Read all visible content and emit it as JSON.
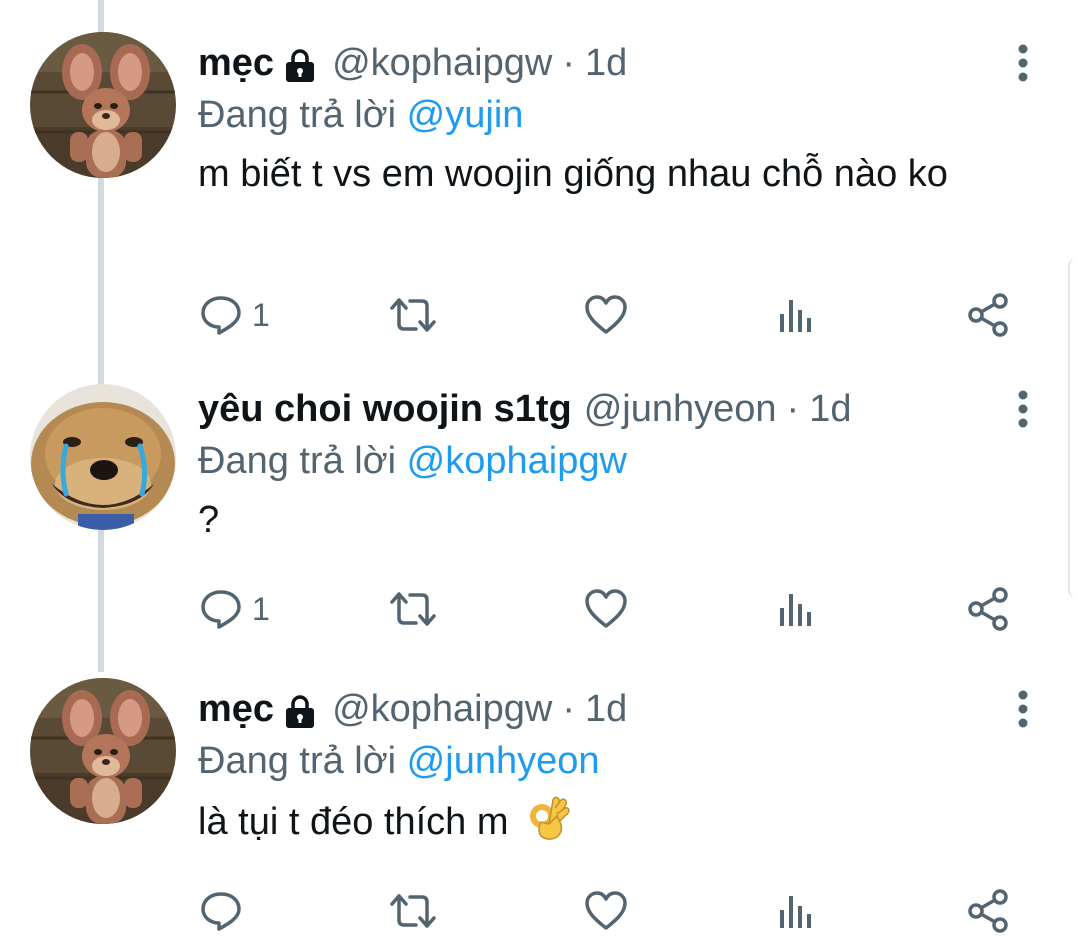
{
  "thread": {
    "tweets": [
      {
        "display_name": "mẹc",
        "locked_icon": "lock-icon",
        "handle": "@kophaipgw",
        "separator": "·",
        "time": "1d",
        "reply_prefix": "Đang trả lời",
        "reply_to": "@yujin",
        "text": "m biết t vs em woojin giống nhau chỗ nào ko",
        "reply_count": "1",
        "avatar": "cartoon-mouse-avatar"
      },
      {
        "display_name": "yêu choi woojin s1tg",
        "handle": "@junhyeon",
        "separator": "·",
        "time": "1d",
        "reply_prefix": "Đang trả lời",
        "reply_to": "@kophaipgw",
        "text": "?",
        "reply_count": "1",
        "avatar": "crying-dog-avatar"
      },
      {
        "display_name": "mẹc",
        "locked_icon": "lock-icon",
        "handle": "@kophaipgw",
        "separator": "·",
        "time": "1d",
        "reply_prefix": "Đang trả lời",
        "reply_to": "@junhyeon",
        "text": "là tụi t đéo thích m",
        "emoji": "ok-hand-emoji",
        "reply_count": "",
        "avatar": "cartoon-mouse-avatar"
      }
    ]
  },
  "colors": {
    "text_primary": "#0f1419",
    "text_secondary": "#536471",
    "mention": "#1d9bf0",
    "thread_line": "#cfd9de"
  }
}
